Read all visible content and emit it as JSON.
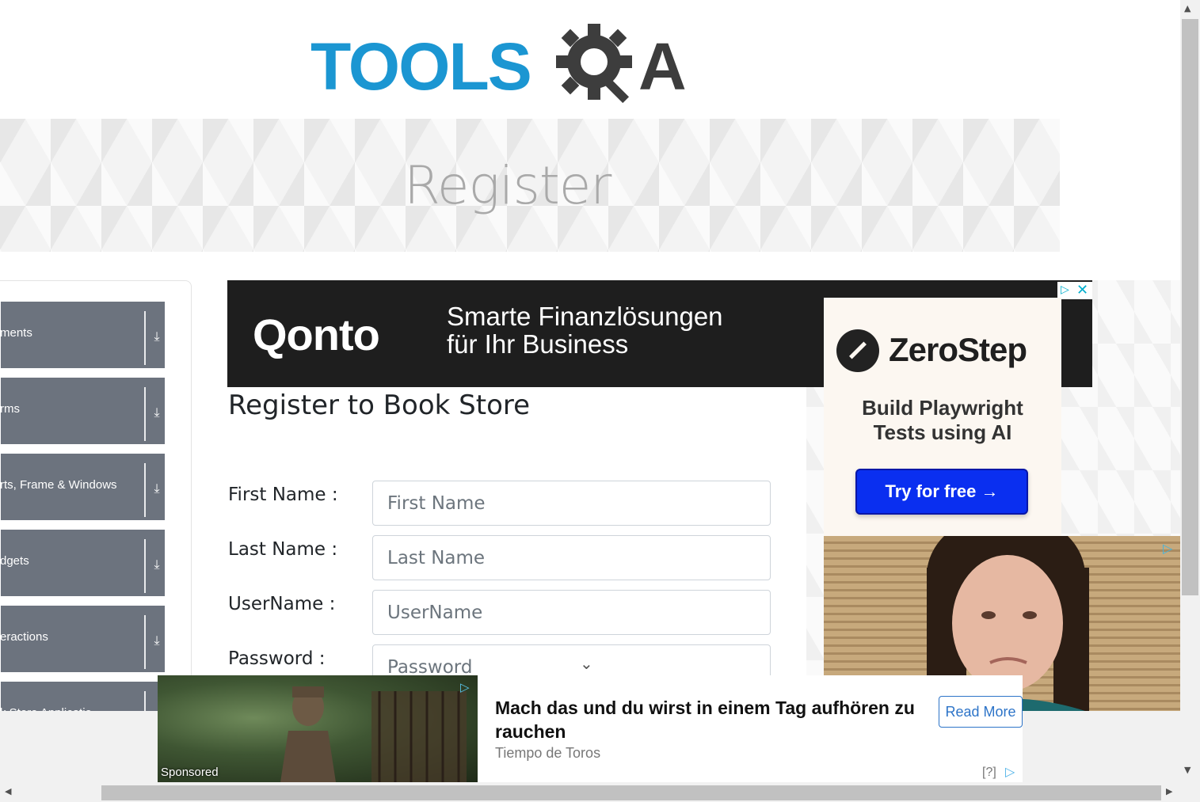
{
  "logo": {
    "tools": "TOOLS",
    "qa_q": "Q",
    "qa_a": "A"
  },
  "banner": {
    "title": "Register"
  },
  "sidebar": {
    "groups": [
      {
        "label": "ments",
        "icon": "download-arrow-icon"
      },
      {
        "label": "rms",
        "icon": "download-arrow-icon"
      },
      {
        "label": "rts, Frame & Windows",
        "icon": "download-arrow-icon"
      },
      {
        "label": "dgets",
        "icon": "download-arrow-icon"
      },
      {
        "label": "eractions",
        "icon": "download-arrow-icon"
      },
      {
        "label": "k Store Applicatio",
        "icon": "download-arrow-icon"
      }
    ]
  },
  "qonto_ad": {
    "brand": "Qonto",
    "line1": "Smarte Finanzlösungen",
    "line2": "für Ihr Business"
  },
  "form": {
    "heading": "Register to Book Store",
    "first_name_label": "First Name :",
    "first_name_placeholder": "First Name",
    "last_name_label": "Last Name :",
    "last_name_placeholder": "Last Name",
    "username_label": "UserName :",
    "username_placeholder": "UserName",
    "password_label": "Password :",
    "password_placeholder": "Password"
  },
  "zerostep_ad": {
    "brand": "ZeroStep",
    "tagline_line1": "Build Playwright",
    "tagline_line2": "Tests using AI",
    "cta": "Try for free →"
  },
  "sponsored_ad": {
    "label": "Sponsored",
    "title": "Mach das und du wirst in einem Tag aufhören zu rauchen",
    "source": "Tiempo de Toros",
    "cta": "Read More",
    "help": "[?]"
  },
  "colors": {
    "brand_blue": "#1b96d2",
    "sidebar_grey": "#6c737e",
    "zerostep_button": "#0a2ff0"
  }
}
